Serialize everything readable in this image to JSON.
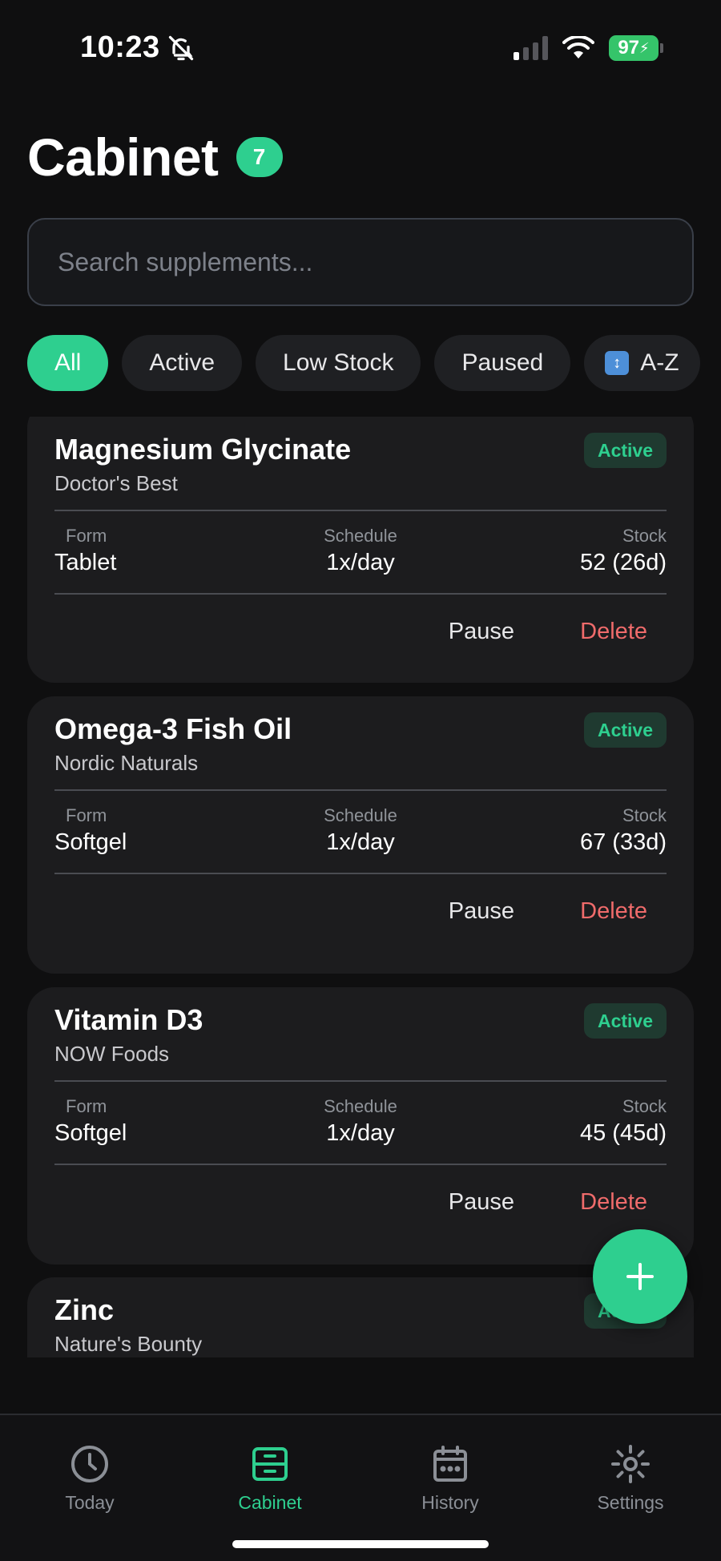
{
  "status_bar": {
    "time": "10:23",
    "battery": "97"
  },
  "header": {
    "title": "Cabinet",
    "count": "7"
  },
  "search": {
    "placeholder": "Search supplements..."
  },
  "filters": {
    "items": [
      "All",
      "Active",
      "Low Stock",
      "Paused"
    ],
    "selected": "All",
    "sort_label": "A-Z"
  },
  "cards": [
    {
      "name": "Magnesium Glycinate",
      "brand": "Doctor's Best",
      "status": "Active",
      "form": "Tablet",
      "schedule": "1x/day",
      "stock": "52 (26d)"
    },
    {
      "name": "Omega-3 Fish Oil",
      "brand": "Nordic Naturals",
      "status": "Active",
      "form": "Softgel",
      "schedule": "1x/day",
      "stock": "67 (33d)"
    },
    {
      "name": "Vitamin D3",
      "brand": "NOW Foods",
      "status": "Active",
      "form": "Softgel",
      "schedule": "1x/day",
      "stock": "45 (45d)"
    },
    {
      "name": "Zinc",
      "brand": "Nature's Bounty",
      "status": "Active"
    }
  ],
  "labels": {
    "form": "Form",
    "schedule": "Schedule",
    "stock": "Stock",
    "pause": "Pause",
    "delete": "Delete"
  },
  "tabbar": {
    "items": [
      {
        "label": "Today",
        "icon": "clock-icon"
      },
      {
        "label": "Cabinet",
        "icon": "cabinet-icon"
      },
      {
        "label": "History",
        "icon": "calendar-icon"
      },
      {
        "label": "Settings",
        "icon": "gear-icon"
      }
    ],
    "selected": "Cabinet"
  },
  "colors": {
    "accent": "#2ecf8f",
    "danger": "#ef6b6b",
    "background": "#0f0f10",
    "card": "#1c1c1e"
  }
}
